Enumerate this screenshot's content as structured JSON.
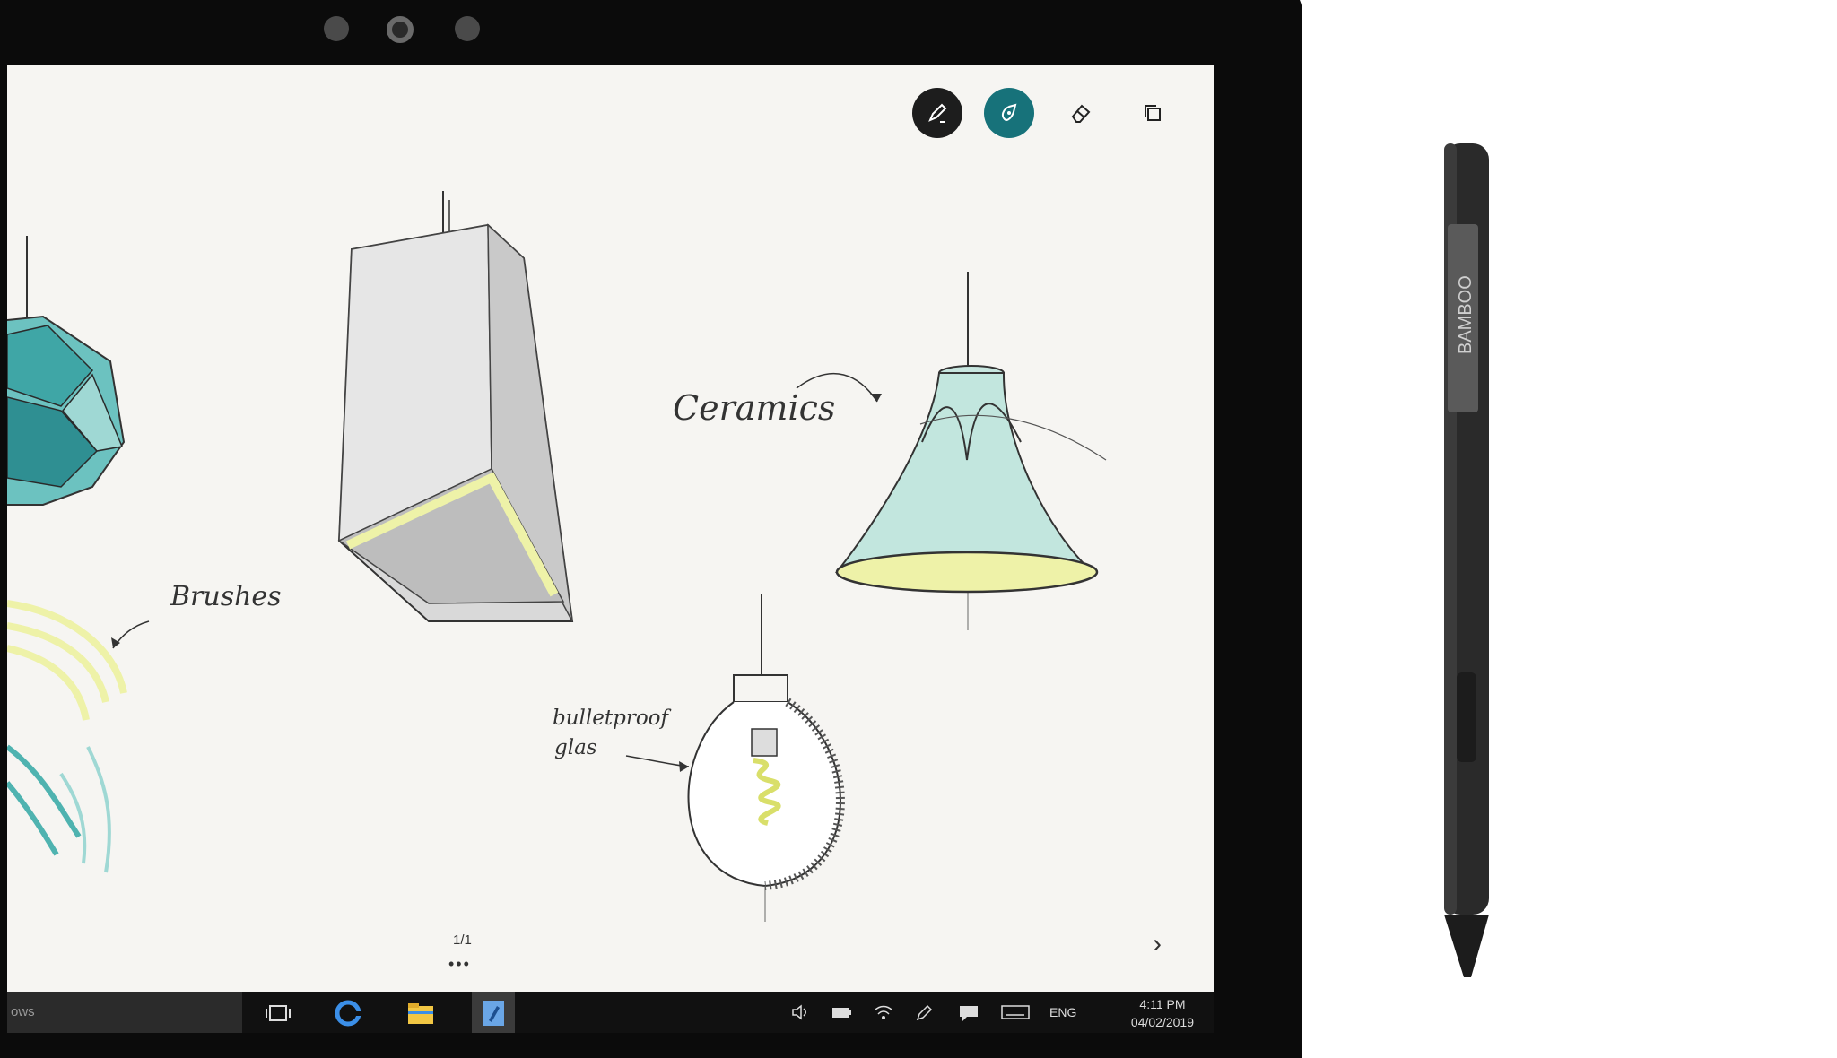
{
  "toolbar": {
    "tools": [
      {
        "name": "pen-tool",
        "icon": "pen-icon",
        "active": false
      },
      {
        "name": "ink-tool",
        "icon": "drop-icon",
        "active": true
      },
      {
        "name": "eraser-tool",
        "icon": "eraser-icon",
        "active": false
      },
      {
        "name": "layers-tool",
        "icon": "layers-icon",
        "active": false
      }
    ]
  },
  "canvas": {
    "annotations": {
      "ceramics": "Ceramics",
      "brushes": "Brushes",
      "bulletproof_line1": "bulletproof",
      "bulletproof_line2": "glas"
    },
    "page_indicator": "1/1",
    "page_dots": "•••",
    "next_arrow": "›"
  },
  "taskbar": {
    "search_text": "ows",
    "tray": {
      "language": "ENG",
      "time": "4:11 PM",
      "date": "04/02/2019"
    }
  },
  "device": {
    "pen_brand": "BAMBOO"
  },
  "colors": {
    "teal_accent": "#17727a",
    "sketch_teal": "#4fb3b0",
    "sketch_yellow": "#eef2a8"
  }
}
